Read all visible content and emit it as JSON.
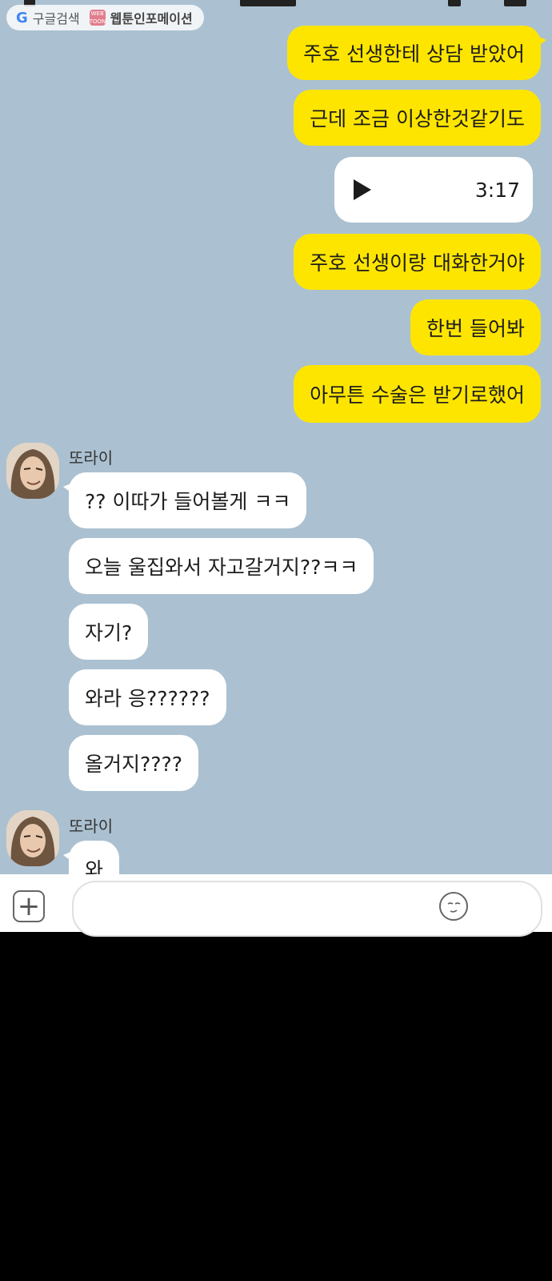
{
  "watermark": {
    "google_label": "구글검색",
    "webtoon_badge": "WEB TOON",
    "webtoon_label": "웹툰인포메이션"
  },
  "outgoing": [
    {
      "text": "주호 선생한테 상담 받았어"
    },
    {
      "text": "근데 조금 이상한것같기도"
    },
    {
      "text": "주호 선생이랑 대화한거야"
    },
    {
      "text": "한번 들어봐"
    },
    {
      "text": "아무튼 수술은 받기로했어"
    }
  ],
  "voice_message": {
    "duration": "3:17",
    "icon": "play-icon"
  },
  "incoming_group1": {
    "sender": "또라이",
    "messages": [
      "?? 이따가 들어볼게 ㅋㅋ",
      "오늘 울집와서 자고갈거지??ㅋㅋ",
      "자기?",
      "와라 응??????",
      "올거지????"
    ]
  },
  "incoming_group2": {
    "sender": "또라이",
    "messages": [
      "와"
    ]
  },
  "input_bar": {
    "plus_icon": "plus-icon",
    "emoji_icon": "emoji-icon",
    "placeholder": ""
  },
  "colors": {
    "chat_bg": "#abc1d1",
    "my_bubble": "#fee500",
    "their_bubble": "#ffffff"
  }
}
